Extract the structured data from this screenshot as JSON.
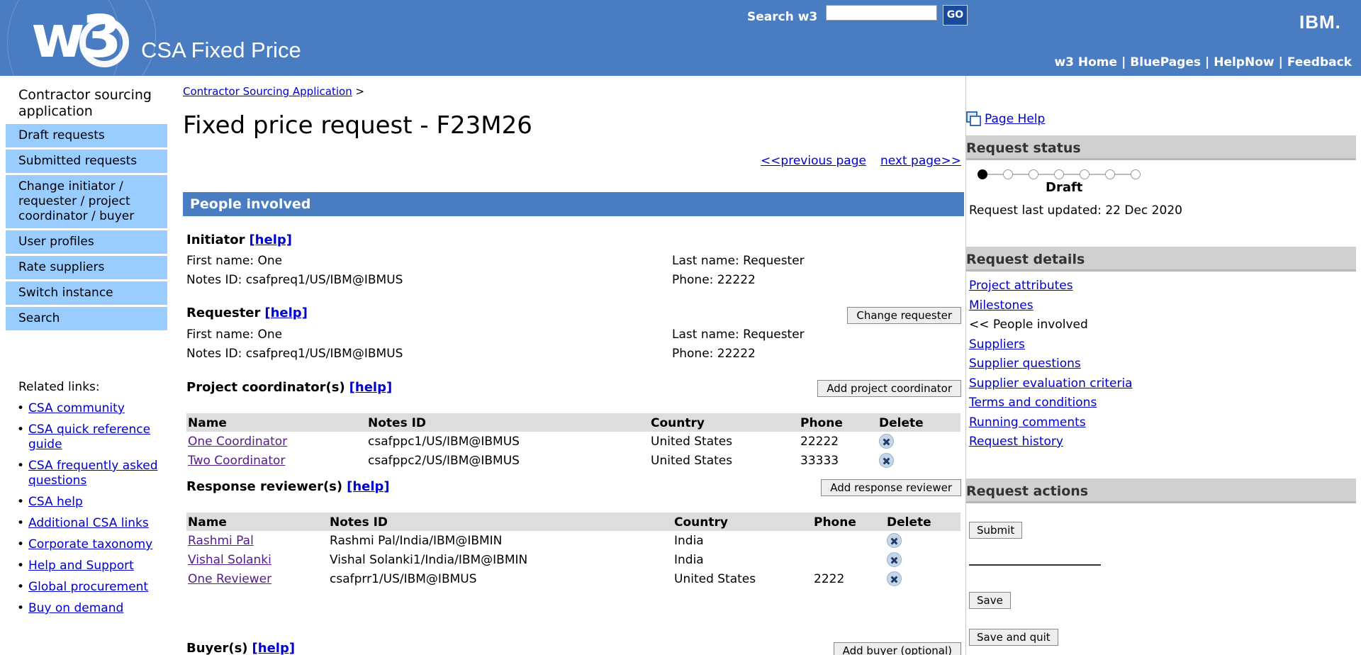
{
  "header": {
    "logo_text": "w3",
    "app_title": "CSA Fixed Price",
    "search_label": "Search w3",
    "search_value": "",
    "go_label": "GO",
    "ibm_logo": "IBM.",
    "links": [
      "w3 Home",
      "BluePages",
      "HelpNow",
      "Feedback"
    ]
  },
  "nav": {
    "heading": "Contractor sourcing application",
    "items": [
      "Draft requests",
      "Submitted requests",
      "Change initiator / requester / project coordinator / buyer",
      "User profiles",
      "Rate suppliers",
      "Switch instance",
      "Search"
    ],
    "related_label": "Related links:",
    "related": [
      "CSA community",
      "CSA quick reference guide",
      "CSA frequently asked questions",
      "CSA help",
      "Additional CSA links",
      "Corporate taxonomy",
      "Help and Support",
      "Global procurement",
      "Buy on demand"
    ]
  },
  "main": {
    "breadcrumb_link": "Contractor Sourcing Application",
    "breadcrumb_sep": ">",
    "title": "Fixed price request - F23M26",
    "prev_page": "<<previous page",
    "next_page": "next page>>",
    "section_title": "People involved",
    "help_link": "[help]",
    "initiator": {
      "heading": "Initiator",
      "first_name": "First name: One",
      "last_name": "Last name: Requester",
      "notes_id": "Notes ID: csafpreq1/US/IBM@IBMUS",
      "phone": "Phone: 22222"
    },
    "requester": {
      "heading": "Requester",
      "button": "Change requester",
      "first_name": "First name: One",
      "last_name": "Last name: Requester",
      "notes_id": "Notes ID: csafpreq1/US/IBM@IBMUS",
      "phone": "Phone: 22222"
    },
    "coordinators": {
      "heading": "Project coordinator(s)",
      "button": "Add project coordinator",
      "columns": [
        "Name",
        "Notes ID",
        "Country",
        "Phone",
        "Delete"
      ],
      "rows": [
        {
          "name": "One Coordinator",
          "notes_id": "csafppc1/US/IBM@IBMUS",
          "country": "United States",
          "phone": "22222"
        },
        {
          "name": "Two Coordinator",
          "notes_id": "csafppc2/US/IBM@IBMUS",
          "country": "United States",
          "phone": "33333"
        }
      ]
    },
    "reviewers": {
      "heading": "Response reviewer(s)",
      "button": "Add response reviewer",
      "columns": [
        "Name",
        "Notes ID",
        "Country",
        "Phone",
        "Delete"
      ],
      "rows": [
        {
          "name": "Rashmi Pal",
          "notes_id": "Rashmi Pal/India/IBM@IBMIN",
          "country": "India",
          "phone": ""
        },
        {
          "name": "Vishal Solanki",
          "notes_id": "Vishal Solanki1/India/IBM@IBMIN",
          "country": "India",
          "phone": ""
        },
        {
          "name": "One Reviewer",
          "notes_id": "csafprr1/US/IBM@IBMUS",
          "country": "United States",
          "phone": "2222"
        }
      ]
    },
    "buyers": {
      "heading": "Buyer(s)",
      "button": "Add buyer (optional)"
    }
  },
  "right": {
    "page_help": "Page Help",
    "status_title": "Request status",
    "status_steps": 7,
    "status_current": 1,
    "status_label": "Draft",
    "last_updated": "Request last updated: 22 Dec 2020",
    "details_title": "Request details",
    "details": [
      {
        "label": "Project attributes",
        "current": false
      },
      {
        "label": "Milestones",
        "current": false
      },
      {
        "label": "<< People involved",
        "current": true
      },
      {
        "label": "Suppliers",
        "current": false
      },
      {
        "label": "Supplier questions",
        "current": false
      },
      {
        "label": "Supplier evaluation criteria",
        "current": false
      },
      {
        "label": "Terms and conditions",
        "current": false
      },
      {
        "label": "Running comments",
        "current": false
      },
      {
        "label": "Request history",
        "current": false
      }
    ],
    "actions_title": "Request actions",
    "actions": {
      "submit": "Submit",
      "save": "Save",
      "save_quit": "Save and quit"
    }
  }
}
